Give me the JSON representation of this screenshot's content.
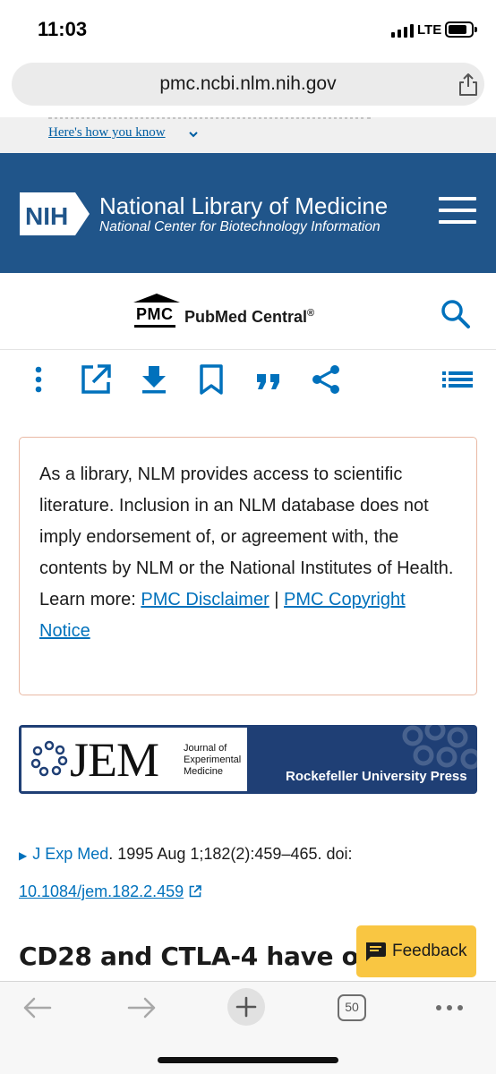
{
  "status_bar": {
    "time": "11:03",
    "network": "LTE"
  },
  "browser": {
    "url": "pmc.ncbi.nlm.nih.gov",
    "tab_count": "50"
  },
  "gov_banner": {
    "link_text": "Here's how you know"
  },
  "nih_header": {
    "logo_text": "NIH",
    "title": "National Library of Medicine",
    "subtitle": "National Center for Biotechnology Information"
  },
  "pmc_header": {
    "logo_abbr": "PMC",
    "logo_name": "PubMed Central",
    "registered_mark": "®"
  },
  "toolbar": {
    "icons": [
      "more-vertical-icon",
      "open-external-icon",
      "download-icon",
      "bookmark-icon",
      "cite-quote-icon",
      "share-icon",
      "list-icon"
    ]
  },
  "disclaimer": {
    "text": "As a library, NLM provides access to scientific literature. Inclusion in an NLM database does not imply endorsement of, or agreement with, the contents by NLM or the National Institutes of Health.",
    "learn_more_prefix": "Learn more: ",
    "link_disclaimer": "PMC Disclaimer",
    "separator": " | ",
    "link_copyright": "PMC Copyright Notice"
  },
  "journal_banner": {
    "abbr": "JEM",
    "full_name_line1": "Journal of",
    "full_name_line2": "Experimental",
    "full_name_line3": "Medicine",
    "publisher": "Rockefeller University Press"
  },
  "citation": {
    "journal": "J Exp Med",
    "details": ". 1995 Aug 1;182(2):459–465. doi: ",
    "doi": "10.1084/jem.182.2.459"
  },
  "article": {
    "title_visible": "CD28 and CTLA-4 have oppos"
  },
  "feedback": {
    "label": "Feedback"
  },
  "colors": {
    "nih_blue": "#20558a",
    "link_blue": "#0071bc",
    "feedback_yellow": "#f9c642",
    "banner_navy": "#1f3f75"
  }
}
